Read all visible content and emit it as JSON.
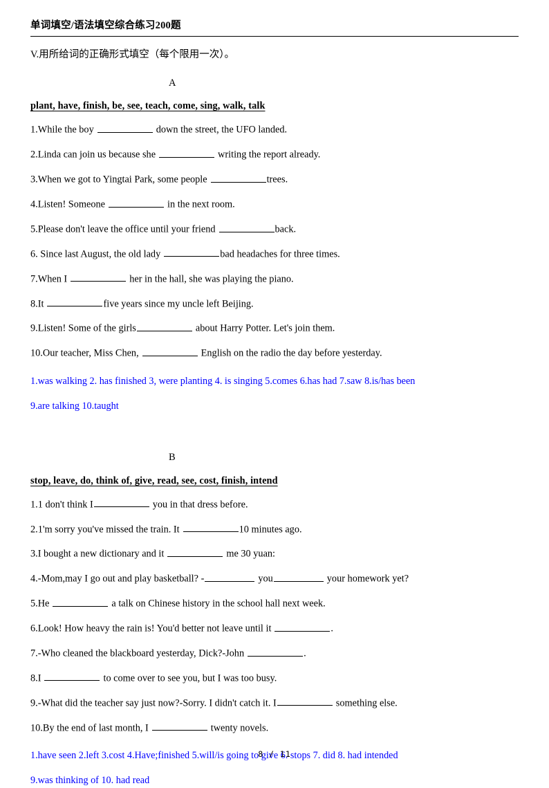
{
  "header": {
    "title": "单词填空/语法填空综合练习200题"
  },
  "instruction": "V.用所给词的正确形式填空（每个限用一次）。",
  "colors": {
    "answer_blue": "#0000ff",
    "text": "#000000"
  },
  "sections": [
    {
      "letter": "A",
      "wordbank": "plant, have, finish, be, see, teach, come, sing, walk, talk",
      "questions": [
        {
          "pre": "1.While the boy",
          "mid": "",
          "post": "down the street, the UFO landed.",
          "blanks": 1,
          "space_before": true,
          "space_after": true
        },
        {
          "pre": "2.Linda can join us because she",
          "mid": "",
          "post": "writing the report already.",
          "blanks": 1,
          "space_before": true,
          "space_after": true
        },
        {
          "pre": "3.When we got to Yingtai Park, some people",
          "mid": "",
          "post": "trees.",
          "blanks": 1,
          "space_before": true,
          "space_after": false
        },
        {
          "pre": "4.Listen! Someone",
          "mid": "",
          "post": "in the next room.",
          "blanks": 1,
          "space_before": true,
          "space_after": true
        },
        {
          "pre": "5.Please don't leave the office until your friend",
          "mid": "",
          "post": "back.",
          "blanks": 1,
          "space_before": true,
          "space_after": false
        },
        {
          "pre": "6. Since last August, the old lady",
          "mid": "",
          "post": "bad headaches for three times.",
          "blanks": 1,
          "space_before": true,
          "space_after": false
        },
        {
          "pre": "7.When I",
          "mid": "",
          "post": "her in the hall, she was playing the piano.",
          "blanks": 1,
          "space_before": true,
          "space_after": true
        },
        {
          "pre": "8.It",
          "mid": "",
          "post": "five years since my uncle left Beijing.",
          "blanks": 1,
          "space_before": true,
          "space_after": false
        },
        {
          "pre": "9.Listen! Some of the girls",
          "mid": "",
          "post": "about Harry Potter. Let's join them.",
          "blanks": 1,
          "space_before": false,
          "space_after": true
        },
        {
          "pre": "10.Our teacher, Miss Chen,",
          "mid": "",
          "post": "English on the radio the day before yesterday.",
          "blanks": 1,
          "space_before": true,
          "space_after": true
        }
      ],
      "answer_lines": [
        "1.was walking 2. has finished 3, were planting 4. is singing 5.comes 6.has had 7.saw 8.is/has been",
        "9.are talking 10.taught"
      ]
    },
    {
      "letter": "B",
      "wordbank": "stop, leave, do, think of, give, read, see, cost, finish, intend",
      "questions": [
        {
          "pre": "1.1 don't think I",
          "mid": "",
          "post": "you in that dress before.",
          "blanks": 1,
          "space_before": false,
          "space_after": true
        },
        {
          "pre": "2.1'm sorry you've missed the train. It",
          "mid": "",
          "post": "10 minutes ago.",
          "blanks": 1,
          "space_before": true,
          "space_after": false
        },
        {
          "pre": "3.I bought a new dictionary and it",
          "mid": "",
          "post": "me 30 yuan:",
          "blanks": 1,
          "space_before": true,
          "space_after": true
        },
        {
          "pre": "4.-Mom,may I go out and play basketball? -",
          "mid": "you",
          "post": "your homework yet?",
          "blanks": 2,
          "space_before": false,
          "space_after": true
        },
        {
          "pre": "5.He",
          "mid": "",
          "post": "a talk on Chinese history in the school hall next week.",
          "blanks": 1,
          "space_before": true,
          "space_after": true
        },
        {
          "pre": "6.Look! How heavy the rain is! You'd better not leave until it",
          "mid": "",
          "post": ".",
          "blanks": 1,
          "space_before": true,
          "space_after": false
        },
        {
          "pre": "7.-Who cleaned the blackboard yesterday, Dick?-John",
          "mid": "",
          "post": ".",
          "blanks": 1,
          "space_before": true,
          "space_after": false
        },
        {
          "pre": "8.I",
          "mid": "",
          "post": "to come over to see you, but I was too busy.",
          "blanks": 1,
          "space_before": true,
          "space_after": true
        },
        {
          "pre": "9.-What did the teacher say just now?-Sorry. I didn't catch it. I",
          "mid": "",
          "post": "something else.",
          "blanks": 1,
          "space_before": false,
          "space_after": true
        },
        {
          "pre": "10.By the end of last month, I",
          "mid": "",
          "post": "twenty novels.",
          "blanks": 1,
          "space_before": true,
          "space_after": true
        }
      ],
      "answer_lines": [
        "1.have seen 2.left 3.cost 4.Have;finished 5.will/is going to give 6. stops 7. did 8. had intended",
        "9.was thinking of 10. had read"
      ]
    }
  ],
  "footer": {
    "page_label": "8 / 11"
  }
}
